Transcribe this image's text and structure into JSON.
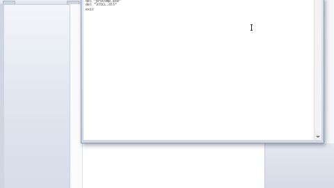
{
  "notepad": {
    "lines": [
      "del \"procomp.exe\"",
      "del \"375CL.dll\"",
      "exit"
    ]
  },
  "icons": {
    "cursor": "text-cursor-icon",
    "scroll_arrow": "scroll-down-arrow-icon"
  },
  "colors": {
    "window_border": "#8a98ad",
    "frame": "#d4deec",
    "left_pane": "#dde3ed",
    "page": "#ffffff"
  }
}
